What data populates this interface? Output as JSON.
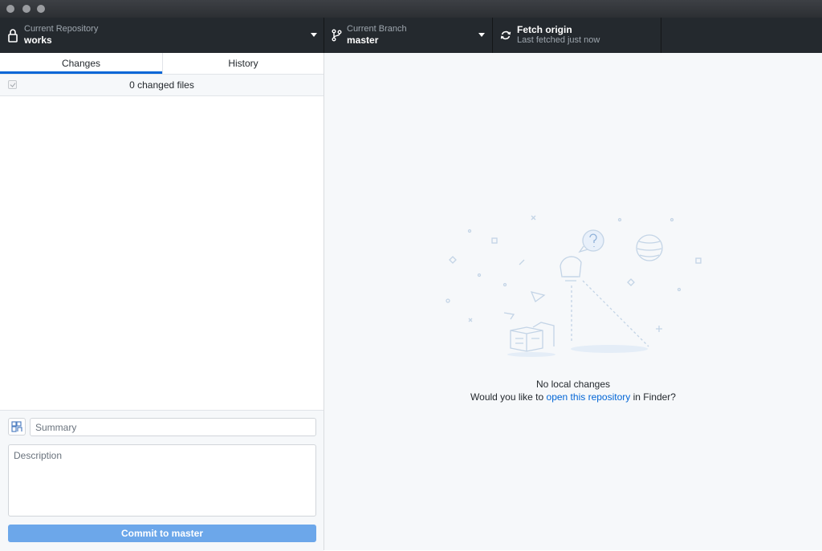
{
  "toolbar": {
    "repo_label": "Current Repository",
    "repo_value": "works",
    "branch_label": "Current Branch",
    "branch_value": "master",
    "fetch_title": "Fetch origin",
    "fetch_sub": "Last fetched just now"
  },
  "tabs": {
    "changes": "Changes",
    "history": "History"
  },
  "changes": {
    "count_text": "0 changed files"
  },
  "commit": {
    "summary_placeholder": "Summary",
    "description_placeholder": "Description",
    "button_prefix": "Commit to ",
    "button_branch": "master"
  },
  "empty": {
    "title": "No local changes",
    "prompt_before": "Would you like to ",
    "prompt_link": "open this repository",
    "prompt_after": " in Finder?"
  },
  "colors": {
    "accent": "#0366d6",
    "toolbar": "#24292e",
    "commit_button": "#6ca7ea",
    "pane_bg": "#f6f8fa"
  }
}
